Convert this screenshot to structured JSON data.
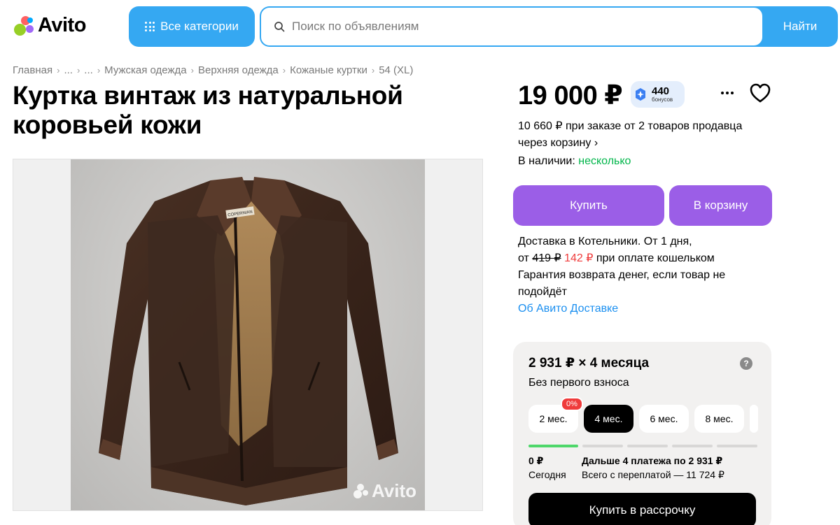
{
  "header": {
    "logo_text": "Avito",
    "categories_label": "Все категории",
    "search_placeholder": "Поиск по объявлениям",
    "search_button": "Найти"
  },
  "breadcrumbs": [
    "Главная",
    "...",
    "...",
    "Мужская одежда",
    "Верхняя одежда",
    "Кожаные куртки",
    "54 (XL)"
  ],
  "listing": {
    "title": "Куртка винтаж из натуральной коровьей кожи",
    "price": "19 000 ₽",
    "bonus_amount": "440",
    "bonus_label": "бонусов",
    "promo_line1": "10 660 ₽ при заказе от 2 товаров продавца",
    "promo_line2": "через корзину ›",
    "availability_label": "В наличии:",
    "availability_value": "несколько",
    "photo_watermark": "Avito",
    "jacket_brand_tag": "COPERNIAN"
  },
  "actions": {
    "buy": "Купить",
    "cart": "В корзину"
  },
  "delivery": {
    "line1": "Доставка в Котельники. От 1 дня,",
    "from": "от",
    "old_price": "419 ₽",
    "new_price": "142 ₽",
    "wallet_text": "при оплате кошельком",
    "guarantee": "Гарантия возврата денег, если товар не подойдёт",
    "link": "Об Авито Доставке"
  },
  "installment": {
    "title": "2 931 ₽ × 4 месяца",
    "subtitle": "Без первого взноса",
    "help": "?",
    "options": [
      {
        "label": "2 мес.",
        "badge": "0%"
      },
      {
        "label": "4 мес."
      },
      {
        "label": "6 мес."
      },
      {
        "label": "8 мес."
      }
    ],
    "today_amount": "0 ₽",
    "today_label": "Сегодня",
    "further": "Дальше 4 платежа по 2 931 ₽",
    "total": "Всего с переплатой — 11 724 ₽",
    "button": "Купить в рассрочку"
  },
  "colors": {
    "brand_blue": "#35a8f2",
    "purple": "#9b5ee7",
    "green": "#02b64b",
    "red": "#ef3b3b",
    "link": "#1a8ff0"
  }
}
